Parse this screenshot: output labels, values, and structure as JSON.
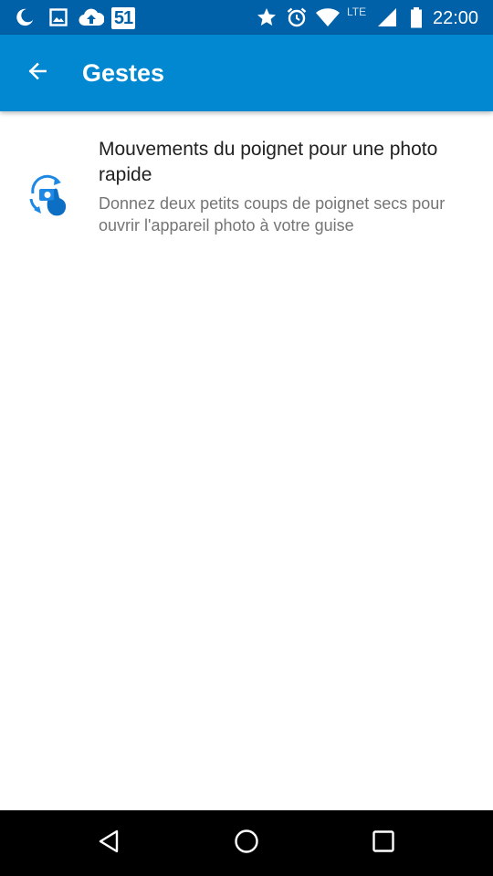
{
  "status_bar": {
    "icons": [
      "moon-icon",
      "image-icon",
      "cloud-upload-icon",
      "star-icon",
      "alarm-icon",
      "wifi-icon",
      "signal-icon",
      "battery-icon"
    ],
    "badge_text": "51",
    "network": "LTE",
    "time": "22:00"
  },
  "app_bar": {
    "back_icon": "arrow-back-icon",
    "title": "Gestes",
    "color": "#0288d1"
  },
  "items": [
    {
      "icon": "wrist-twist-camera-icon",
      "title": "Mouvements du poignet pour une photo rapide",
      "summary": "Donnez deux petits coups de poignet secs pour ouvrir l'appareil photo à votre guise"
    }
  ],
  "nav_bar": {
    "buttons": [
      "back-triangle-icon",
      "home-circle-icon",
      "recents-square-icon"
    ]
  }
}
